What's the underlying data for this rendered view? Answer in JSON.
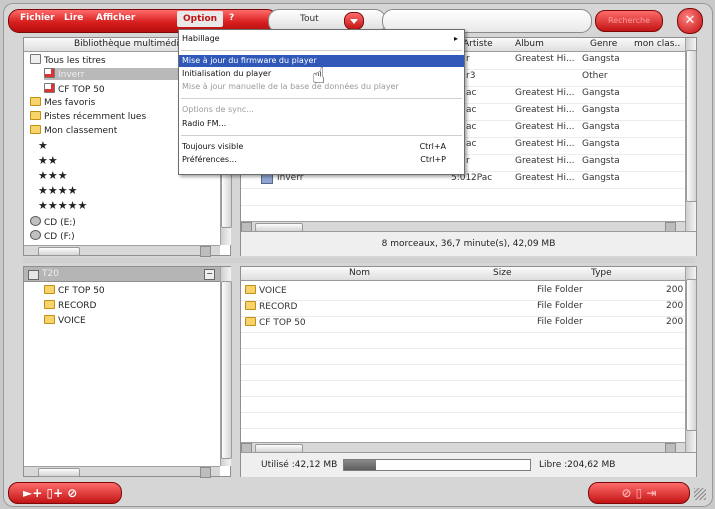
{
  "menubar": {
    "items": [
      "Fichier",
      "Lire",
      "Afficher",
      "Option",
      "?"
    ]
  },
  "filter": {
    "value": "Tout"
  },
  "search": {
    "button_label": "Recherche"
  },
  "library": {
    "header": "Bibliothèque multimédi",
    "tree": [
      "Tous les titres",
      "Inverr",
      "CF TOP 50",
      "Mes favoris",
      "Pistes récemment lues",
      "Mon classement",
      "★",
      "★★",
      "★★★",
      "★★★★",
      "★★★★★",
      "CD (E:)",
      "CD (F:)"
    ]
  },
  "tracks": {
    "columns": [
      "Artiste",
      "Album",
      "Genre",
      "mon clas.."
    ],
    "rows": [
      {
        "artist": "r",
        "album": "Greatest Hi...",
        "genre": "Gangsta"
      },
      {
        "artist": "r3",
        "album": "",
        "genre": "Other"
      },
      {
        "artist": "ac",
        "album": "Greatest Hi...",
        "genre": "Gangsta"
      },
      {
        "artist": "ac",
        "album": "Greatest Hi...",
        "genre": "Gangsta"
      },
      {
        "artist": "ac",
        "album": "Greatest Hi...",
        "genre": "Gangsta"
      },
      {
        "artist": "ac",
        "album": "Greatest Hi...",
        "genre": "Gangsta"
      },
      {
        "artist": "r",
        "album": "Greatest Hi...",
        "genre": "Gangsta"
      },
      {
        "title": "Inverr",
        "time": "5:01",
        "artist": "2Pac",
        "album": "Greatest Hi...",
        "genre": "Gangsta"
      }
    ],
    "status": "8 morceaux, 36,7 minute(s), 42,09 MB"
  },
  "device": {
    "tree_title": "T20",
    "tree": [
      "CF TOP 50",
      "RECORD",
      "VOICE"
    ],
    "columns": [
      "Nom",
      "Size",
      "Type"
    ],
    "files": [
      {
        "name": "VOICE",
        "type": "File Folder",
        "date": "200"
      },
      {
        "name": "RECORD",
        "type": "File Folder",
        "date": "200"
      },
      {
        "name": "CF TOP 50",
        "type": "File Folder",
        "date": "200"
      }
    ],
    "used": "Utilisé :42,12 MB",
    "free": "Libre :204,62 MB",
    "used_fraction": 0.17
  },
  "option_menu": {
    "items": [
      {
        "label": "Habillage",
        "shortcut": ""
      },
      {
        "label": "Mise à jour du firmware du player",
        "shortcut": ""
      },
      {
        "label": "Initialisation du player",
        "shortcut": ""
      },
      {
        "label": "Mise à jour manuelle de la base de données du player",
        "shortcut": ""
      },
      {
        "label": "Options de sync...",
        "shortcut": ""
      },
      {
        "label": "Radio FM...",
        "shortcut": ""
      },
      {
        "label": "Toujours visible",
        "shortcut": "Ctrl+A"
      },
      {
        "label": "Préférences...",
        "shortcut": "Ctrl+P"
      }
    ]
  },
  "bottom_bar": {
    "left_label": "►+ ▯+ ⊘",
    "right_label": "⊘ ▯ ⇥"
  }
}
